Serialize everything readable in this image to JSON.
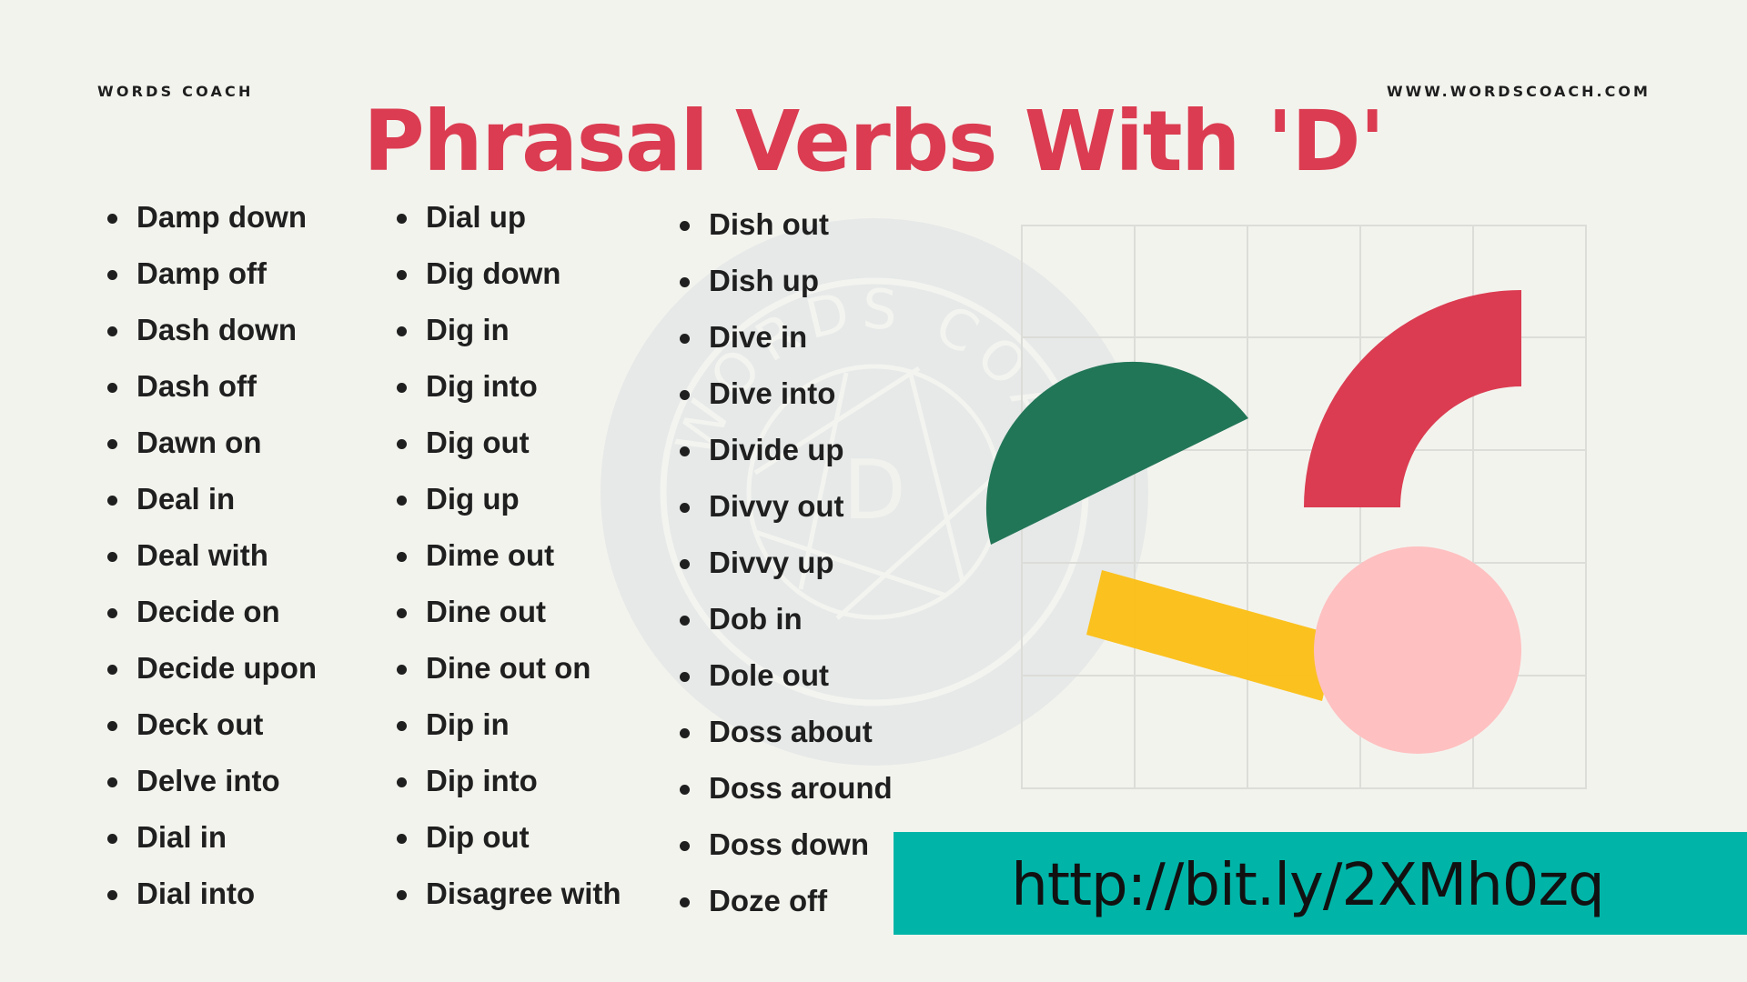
{
  "header": {
    "brand_left": "WORDS COACH",
    "brand_right": "WWW.WORDSCOACH.COM",
    "title": "Phrasal Verbs With 'D'"
  },
  "watermark": {
    "text": "WORDS COACH",
    "letter": "D"
  },
  "lists": {
    "column1": [
      "Damp down",
      "Damp off",
      "Dash down",
      "Dash off",
      "Dawn on",
      "Deal in",
      "Deal with",
      "Decide on",
      "Decide upon",
      "Deck out",
      "Delve into",
      "Dial in",
      "Dial into"
    ],
    "column2": [
      "Dial up",
      "Dig down",
      "Dig in",
      "Dig into",
      "Dig out",
      "Dig up",
      "Dime out",
      "Dine out",
      "Dine out on",
      "Dip in",
      "Dip into",
      "Dip out",
      "Disagree with"
    ],
    "column3": [
      "Dish out",
      "Dish up",
      "Dive in",
      "Dive into",
      "Divide up",
      "Divvy out",
      "Divvy up",
      "Dob in",
      "Dole out",
      "Doss about",
      "Doss around",
      "Doss down",
      "Doze off"
    ]
  },
  "banner": {
    "link_text": "http://bit.ly/2XMh0zq"
  },
  "colors": {
    "title": "#db3c51",
    "background": "#f3f3ee",
    "banner": "#00b5a8",
    "shape_green": "#1e7355",
    "shape_red": "#db3c51",
    "shape_pink": "#fec0c0",
    "shape_yellow": "#fbbf17"
  }
}
